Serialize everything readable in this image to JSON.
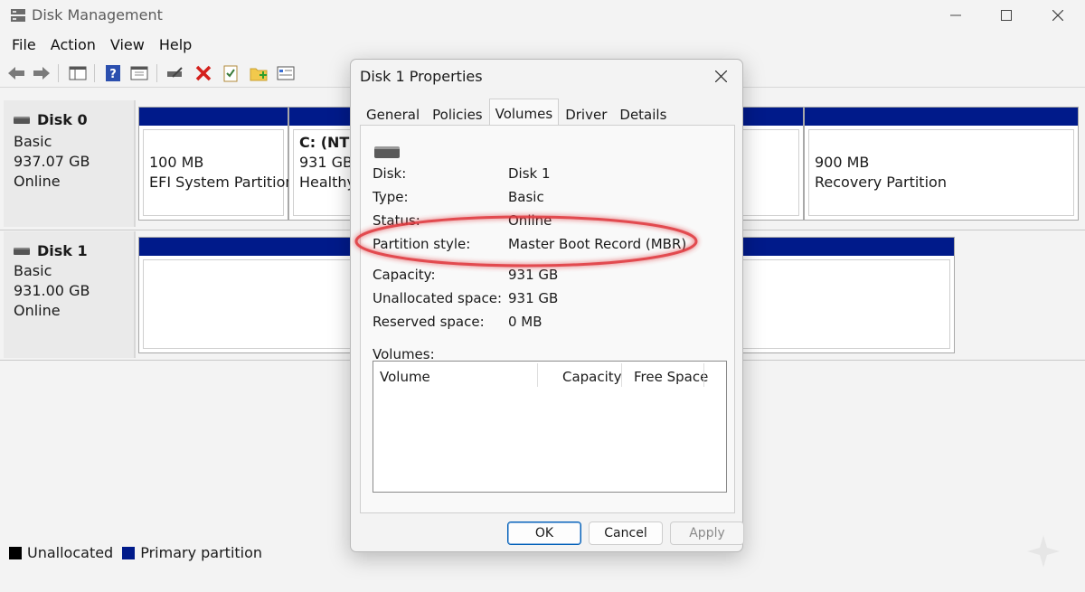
{
  "window": {
    "title": "Disk Management",
    "app_icon": "disk-management-icon"
  },
  "menu": [
    "File",
    "Action",
    "View",
    "Help"
  ],
  "toolbar_icons": [
    "back-arrow-icon",
    "forward-arrow-icon",
    "console-tree-icon",
    "help-icon",
    "properties-icon",
    "connect-drive-icon",
    "delete-icon",
    "checklist-icon",
    "new-folder-icon",
    "settings-panel-icon"
  ],
  "disks": [
    {
      "name": "Disk 0",
      "type": "Basic",
      "size": "937.07 GB",
      "status": "Online",
      "partitions": [
        {
          "line1": "100 MB",
          "line2": "EFI System Partition"
        },
        {
          "line1": "C:  (NTF",
          "line2": "931 GB",
          "line3": "Healthy"
        },
        {
          "line1": "900 MB",
          "line2": "Recovery Partition"
        }
      ]
    },
    {
      "name": "Disk 1",
      "type": "Basic",
      "size": "931.00 GB",
      "status": "Online"
    }
  ],
  "legend": [
    {
      "label": "Unallocated",
      "color": "#000000"
    },
    {
      "label": "Primary partition",
      "color": "#001a8a"
    }
  ],
  "dialog": {
    "title": "Disk 1 Properties",
    "tabs": [
      "General",
      "Policies",
      "Volumes",
      "Driver",
      "Details"
    ],
    "active_tab": "Volumes",
    "props": {
      "disk_label": "Disk:",
      "disk_value": "Disk 1",
      "type_label": "Type:",
      "type_value": "Basic",
      "status_label": "Status:",
      "status_value": "Online",
      "partition_style_label": "Partition style:",
      "partition_style_value": "Master Boot Record (MBR)",
      "capacity_label": "Capacity:",
      "capacity_value": "931 GB",
      "unallocated_label": "Unallocated space:",
      "unallocated_value": "931 GB",
      "reserved_label": "Reserved space:",
      "reserved_value": "0 MB"
    },
    "volumes_label": "Volumes:",
    "volume_columns": [
      "Volume",
      "Capacity",
      "Free Space"
    ],
    "buttons": {
      "ok": "OK",
      "cancel": "Cancel",
      "apply": "Apply"
    },
    "highlight_color": "#e0393e"
  }
}
